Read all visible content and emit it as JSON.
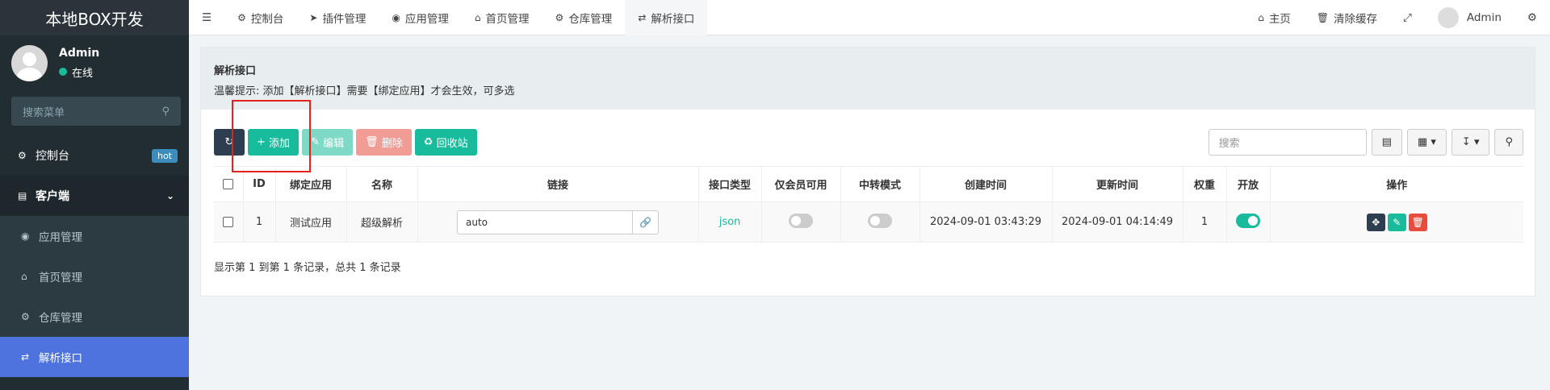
{
  "sidebar": {
    "brand": "本地BOX开发",
    "user": {
      "name": "Admin",
      "status": "在线"
    },
    "search_placeholder": "搜索菜单",
    "items": [
      {
        "label": "控制台",
        "badge": "hot"
      },
      {
        "label": "客户端"
      },
      {
        "label": "应用管理"
      },
      {
        "label": "首页管理"
      },
      {
        "label": "仓库管理"
      },
      {
        "label": "解析接口"
      }
    ]
  },
  "topnav": {
    "tabs": [
      "控制台",
      "插件管理",
      "应用管理",
      "首页管理",
      "仓库管理",
      "解析接口"
    ],
    "right": {
      "home": "主页",
      "clear_cache": "清除缓存",
      "user": "Admin"
    }
  },
  "page": {
    "title": "解析接口",
    "tip": "温馨提示: 添加【解析接口】需要【绑定应用】才会生效，可多选"
  },
  "toolbar": {
    "add": "添加",
    "edit": "编辑",
    "delete": "删除",
    "recycle": "回收站",
    "search_placeholder": "搜索"
  },
  "table": {
    "headers": [
      "",
      "ID",
      "绑定应用",
      "名称",
      "链接",
      "接口类型",
      "仅会员可用",
      "中转模式",
      "创建时间",
      "更新时间",
      "权重",
      "开放",
      "操作"
    ],
    "rows": [
      {
        "id": "1",
        "app": "测试应用",
        "name": "超级解析",
        "link": "auto",
        "type": "json",
        "member_only": false,
        "relay": false,
        "created": "2024-09-01 03:43:29",
        "updated": "2024-09-01 04:14:49",
        "weight": "1",
        "open": true
      }
    ]
  },
  "footer": "显示第 1 到第 1 条记录，总共 1 条记录",
  "colors": {
    "sidebar": "#222d32",
    "active": "#4e73df",
    "success": "#18bc9c",
    "danger": "#e74c3c"
  }
}
